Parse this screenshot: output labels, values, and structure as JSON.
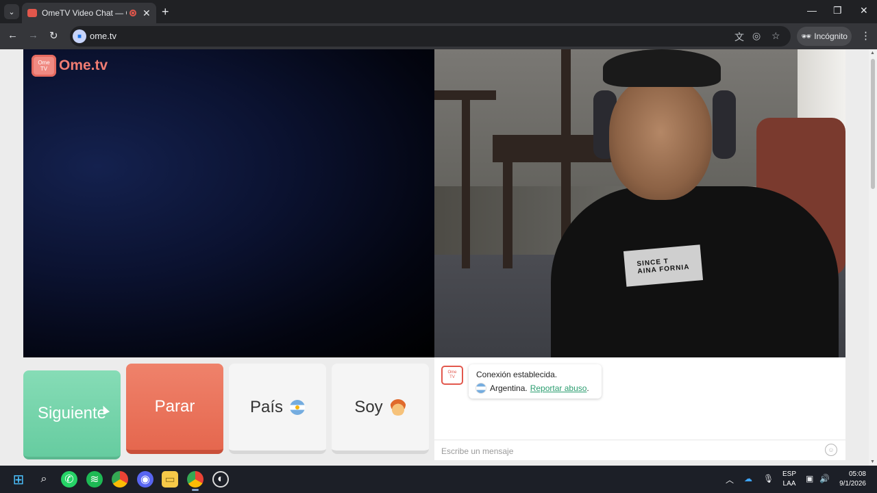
{
  "browser": {
    "tab_title": "OmeTV Video Chat — Ome",
    "url": "ome.tv",
    "incognito_label": "Incógnito",
    "icons": [
      "tab-search-icon",
      "new-tab-icon",
      "minimize-icon",
      "maximize-icon",
      "close-window-icon",
      "back-icon",
      "forward-icon",
      "reload-icon",
      "translate-icon",
      "eye-off-icon",
      "bookmark-star-icon",
      "incognito-icon",
      "menu-icon"
    ]
  },
  "page": {
    "logo_line1": "Ome",
    "logo_line2": "TV",
    "logo_text": "Ome.tv",
    "shirt_line1": "SINCE T",
    "shirt_line2": "AINA FORNIA",
    "buttons": {
      "next": "Siguiente",
      "stop": "Parar",
      "country": "País",
      "gender": "Soy"
    },
    "chat": {
      "status": "Conexión establecida.",
      "country": "Argentina.",
      "report_link": "Reportar abuso",
      "report_suffix": ".",
      "input_placeholder": "Escribe un mensaje"
    },
    "colors": {
      "next": "#74d4aa",
      "stop": "#ea7158",
      "accent": "#2a9d6f",
      "logo": "#f07c72"
    }
  },
  "taskbar": {
    "lang_line1": "ESP",
    "lang_line2": "LAA",
    "time": "05:08",
    "date": "9/1/2026"
  }
}
